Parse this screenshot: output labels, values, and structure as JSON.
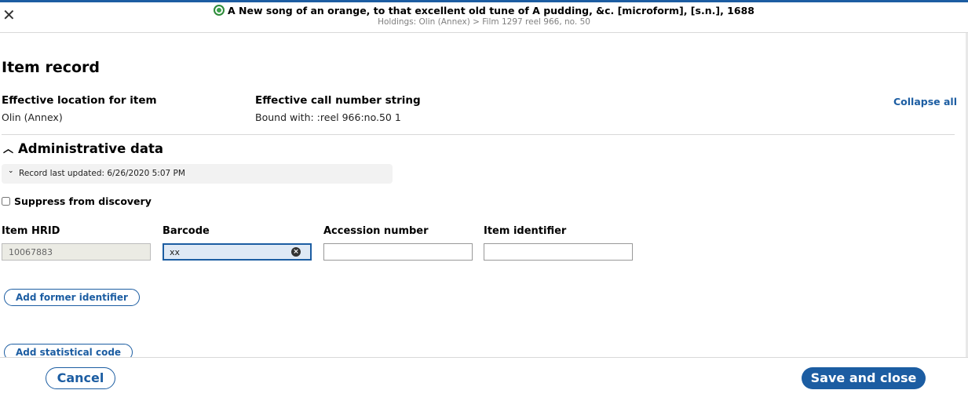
{
  "header": {
    "title": "A New song of an orange, to that excellent old tune of A pudding, &c. [microform], [s.n.], 1688",
    "subtitle": "Holdings: Olin (Annex) > Film 1297 reel 966, no. 50",
    "close_icon": "close-icon",
    "status_icon": "instance-status-icon",
    "status_color": "#3aa14a"
  },
  "item_record": {
    "heading": "Item record",
    "effective_location_label": "Effective location for item",
    "effective_location_value": "Olin (Annex)",
    "call_number_label": "Effective call number string",
    "call_number_value": "Bound with: :reel 966:no.50 1",
    "collapse_all": "Collapse all"
  },
  "admin": {
    "heading": "Administrative data",
    "record_last_updated": "Record last updated: 6/26/2020 5:07 PM",
    "suppress_label": "Suppress from discovery",
    "suppress_checked": false,
    "fields": {
      "hrid_label": "Item HRID",
      "hrid_value": "10067883",
      "barcode_label": "Barcode",
      "barcode_value": "xx",
      "accession_label": "Accession number",
      "accession_value": "",
      "identifier_label": "Item identifier",
      "identifier_value": ""
    },
    "add_former_identifier": "Add former identifier",
    "add_statistical_code": "Add statistical code"
  },
  "footer": {
    "cancel": "Cancel",
    "save_and_close": "Save and close"
  },
  "colors": {
    "accent": "#1c5da2",
    "focused_field_bg": "#dfe9f5",
    "disabled_field_bg": "#ebebe4"
  }
}
